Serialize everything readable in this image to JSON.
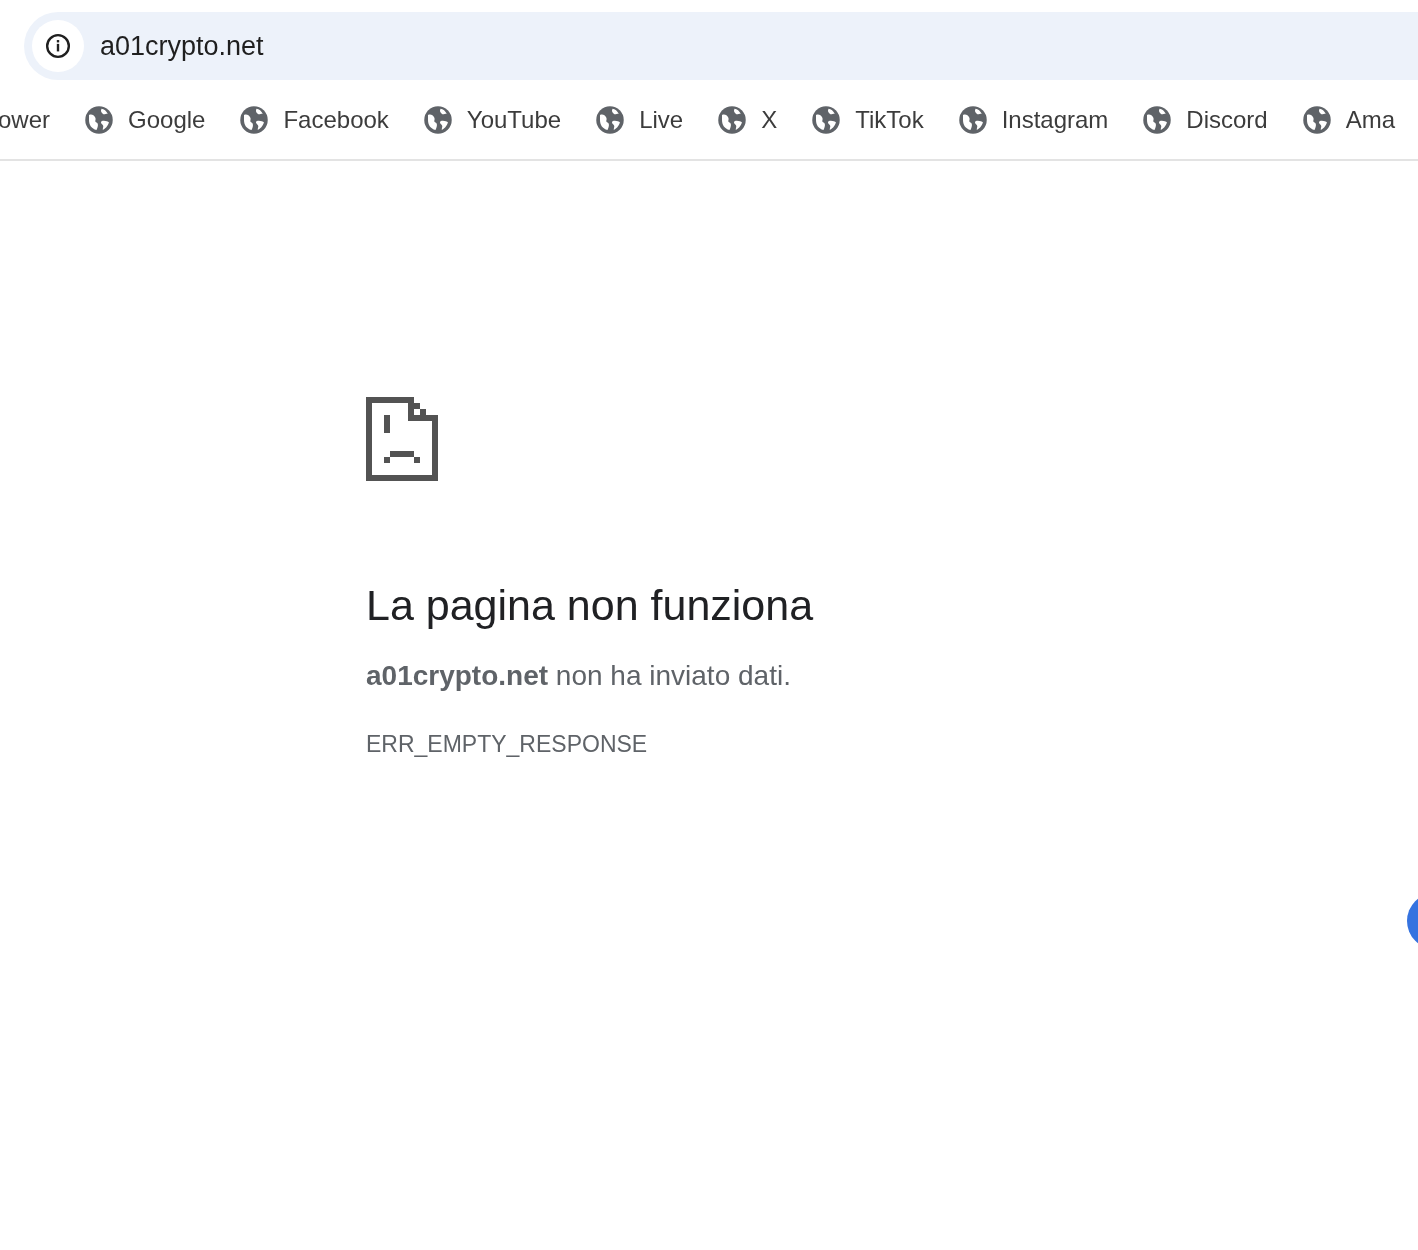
{
  "address_bar": {
    "url": "a01crypto.net"
  },
  "bookmarks": [
    {
      "label": "ower",
      "kind": "cut"
    },
    {
      "label": "Google",
      "kind": "site"
    },
    {
      "label": "Facebook",
      "kind": "site"
    },
    {
      "label": "YouTube",
      "kind": "site"
    },
    {
      "label": "Live",
      "kind": "site"
    },
    {
      "label": "X",
      "kind": "site"
    },
    {
      "label": "TikTok",
      "kind": "site"
    },
    {
      "label": "Instagram",
      "kind": "site"
    },
    {
      "label": "Discord",
      "kind": "site"
    },
    {
      "label": "Ama",
      "kind": "site"
    }
  ],
  "error": {
    "title": "La pagina non funziona",
    "message": "**a01crypto.net** non ha inviato dati.",
    "code": "ERR_EMPTY_RESPONSE"
  }
}
